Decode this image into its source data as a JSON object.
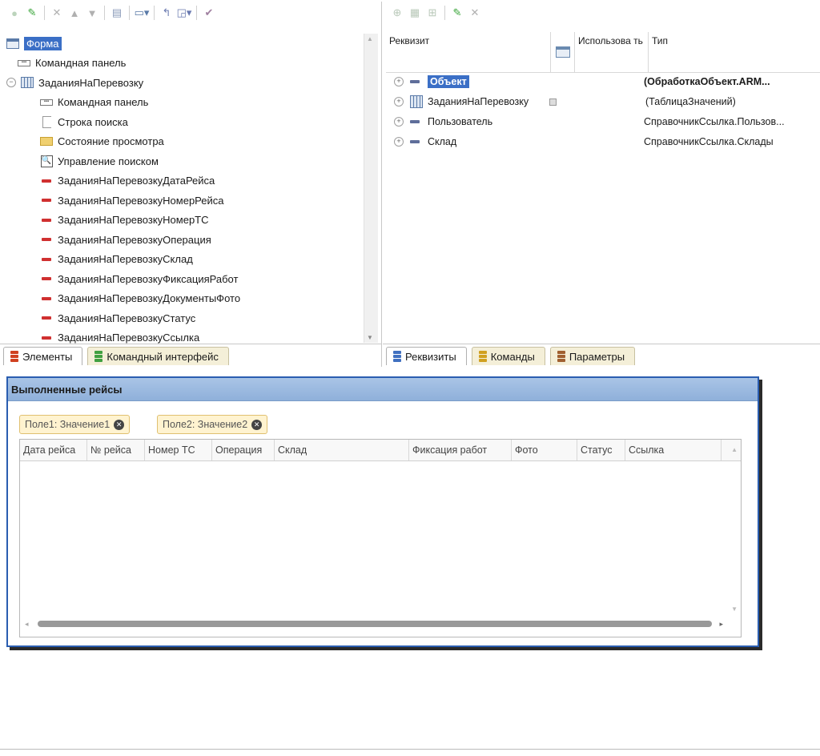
{
  "left_pane": {
    "toolbar_icons": [
      "add-icon",
      "pencil-icon",
      "delete-icon",
      "move-up-icon",
      "move-down-icon",
      "form-icon",
      "monitor-dropdown-icon",
      "arrow-icon",
      "window-dropdown-icon",
      "check-icon"
    ],
    "tree": [
      {
        "label": "Форма",
        "level": 0,
        "icon": "form",
        "selected": true
      },
      {
        "label": "Командная панель",
        "level": 1,
        "icon": "cmdpanel"
      },
      {
        "label": "ЗаданияНаПеревозку",
        "level": 0,
        "icon": "table",
        "expander": "⊖"
      },
      {
        "label": "Командная панель",
        "level": 2,
        "icon": "cmdpanel"
      },
      {
        "label": "Строка поиска",
        "level": 2,
        "icon": "searchline"
      },
      {
        "label": "Состояние просмотра",
        "level": 2,
        "icon": "viewstate"
      },
      {
        "label": "Управление поиском",
        "level": 2,
        "icon": "searchmgmt"
      },
      {
        "label": "ЗаданияНаПеревозкуДатаРейса",
        "level": 2,
        "icon": "field"
      },
      {
        "label": "ЗаданияНаПеревозкуНомерРейса",
        "level": 2,
        "icon": "field"
      },
      {
        "label": "ЗаданияНаПеревозкуНомерТС",
        "level": 2,
        "icon": "field"
      },
      {
        "label": "ЗаданияНаПеревозкуОперация",
        "level": 2,
        "icon": "field"
      },
      {
        "label": "ЗаданияНаПеревозкуСклад",
        "level": 2,
        "icon": "field"
      },
      {
        "label": "ЗаданияНаПеревозкуФиксацияРабот",
        "level": 2,
        "icon": "field"
      },
      {
        "label": "ЗаданияНаПеревозкуДокументыФото",
        "level": 2,
        "icon": "field"
      },
      {
        "label": "ЗаданияНаПеревозкуСтатус",
        "level": 2,
        "icon": "field"
      },
      {
        "label": "ЗаданияНаПеревозкуСсылка",
        "level": 2,
        "icon": "field"
      }
    ],
    "tabs": [
      {
        "label": "Элементы",
        "active": true,
        "color": "#d04020"
      },
      {
        "label": "Командный интерфейс",
        "active": false,
        "color": "#40a040"
      }
    ]
  },
  "right_pane": {
    "toolbar_icons": [
      "attr-add-icon",
      "attr-table-icon",
      "attr-column-icon",
      "pencil-icon",
      "delete-icon"
    ],
    "headers": {
      "attr": "Реквизит",
      "use": "Использова ть",
      "type": "Тип"
    },
    "rows": [
      {
        "name": "Объект",
        "type": "(ОбработкаОбъект.ARM...",
        "bold": true,
        "selected": true,
        "icon": "dash"
      },
      {
        "name": "ЗаданияНаПеревозку",
        "type": "(ТаблицаЗначений)",
        "icon": "table",
        "use_box": true
      },
      {
        "name": "Пользователь",
        "type": "СправочникСсылка.Пользов...",
        "icon": "dash"
      },
      {
        "name": "Склад",
        "type": "СправочникСсылка.Склады",
        "icon": "dash"
      }
    ],
    "tabs": [
      {
        "label": "Реквизиты",
        "active": true,
        "color": "#4070c0"
      },
      {
        "label": "Команды",
        "active": false,
        "color": "#d0a020"
      },
      {
        "label": "Параметры",
        "active": false,
        "color": "#a06030"
      }
    ]
  },
  "form": {
    "title": "Выполненные рейсы",
    "chips": [
      {
        "label": "Поле1: Значение1"
      },
      {
        "label": "Поле2: Значение2"
      }
    ],
    "columns": [
      {
        "label": "Дата рейса",
        "w": 84
      },
      {
        "label": "№ рейса",
        "w": 72
      },
      {
        "label": "Номер ТС",
        "w": 84
      },
      {
        "label": "Операция",
        "w": 78
      },
      {
        "label": "Склад",
        "w": 168
      },
      {
        "label": "Фиксация работ",
        "w": 128
      },
      {
        "label": "Фото",
        "w": 82
      },
      {
        "label": "Статус",
        "w": 60
      },
      {
        "label": "Ссылка",
        "w": 120
      }
    ]
  }
}
